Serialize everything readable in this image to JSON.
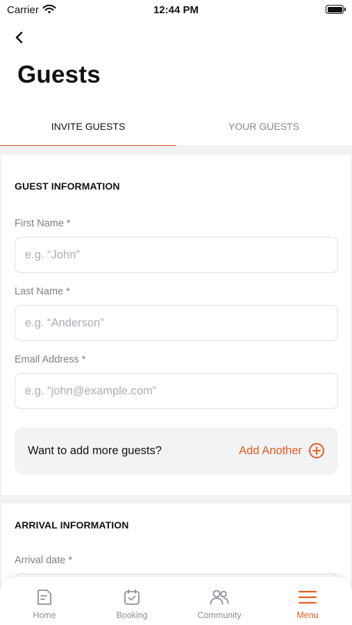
{
  "status_bar": {
    "carrier": "Carrier",
    "time": "12:44 PM"
  },
  "header": {
    "title": "Guests"
  },
  "tabs": [
    {
      "label": "INVITE GUESTS",
      "active": true
    },
    {
      "label": "YOUR GUESTS",
      "active": false
    }
  ],
  "guest_info": {
    "section_title": "GUEST INFORMATION",
    "first_name": {
      "label": "First Name *",
      "value": "",
      "placeholder": "e.g. “John”"
    },
    "last_name": {
      "label": "Last Name *",
      "value": "",
      "placeholder": "e.g. “Anderson”"
    },
    "email": {
      "label": "Email Address *",
      "value": "",
      "placeholder": "e.g. “john@example.com”"
    },
    "more_guests": {
      "question": "Want to add more guests?",
      "add_label": "Add Another"
    }
  },
  "arrival_info": {
    "section_title": "ARRIVAL INFORMATION",
    "arrival_date": {
      "label": "Arrival date *"
    }
  },
  "bottom_nav": [
    {
      "label": "Home",
      "icon": "home-icon",
      "active": false
    },
    {
      "label": "Booking",
      "icon": "calendar-check-icon",
      "active": false
    },
    {
      "label": "Community",
      "icon": "people-icon",
      "active": false
    },
    {
      "label": "Menu",
      "icon": "menu-icon",
      "active": true
    }
  ],
  "colors": {
    "accent": "#ea5b1c",
    "text": "#111111",
    "muted": "#7b8189",
    "background": "#f1f2f3"
  }
}
